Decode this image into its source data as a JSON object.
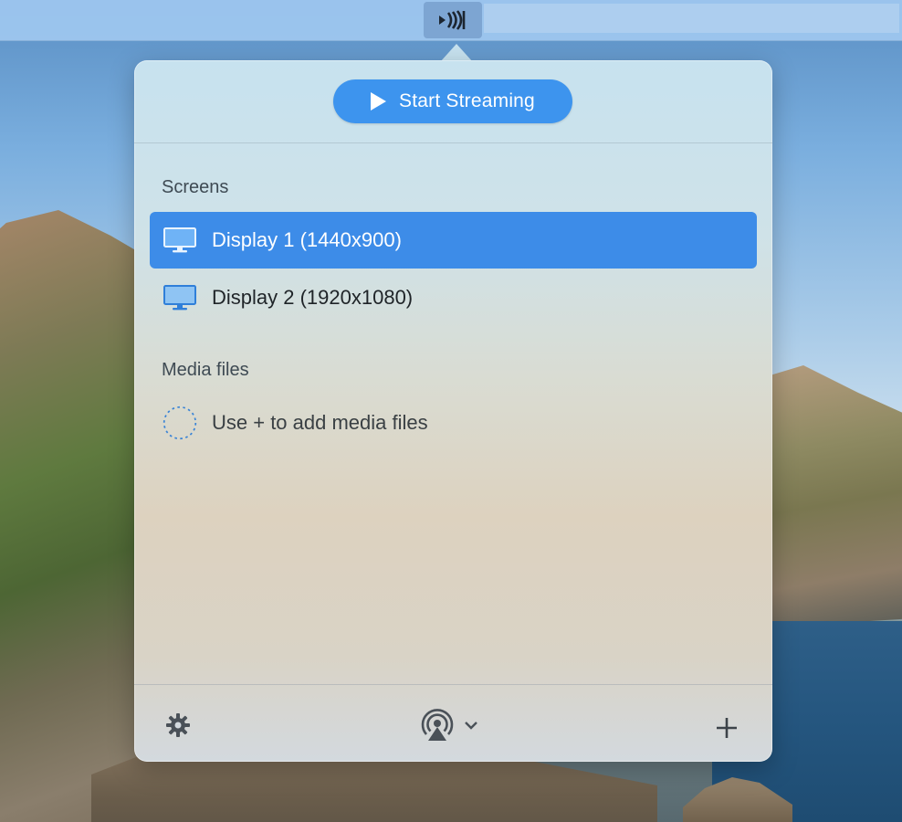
{
  "menubar": {
    "app_icon": "airbeam-stream-icon"
  },
  "header": {
    "start_label": "Start Streaming",
    "start_icon": "play-icon"
  },
  "screens": {
    "title": "Screens",
    "items": [
      {
        "label": "Display 1 (1440x900)",
        "icon": "monitor-icon",
        "selected": true
      },
      {
        "label": "Display 2 (1920x1080)",
        "icon": "monitor-icon",
        "selected": false
      }
    ]
  },
  "media": {
    "title": "Media files",
    "empty_label": "Use + to add media files",
    "empty_icon": "dashed-circle-icon"
  },
  "footer": {
    "settings_icon": "gear-icon",
    "airplay_icon": "airplay-icon",
    "chevron_icon": "chevron-down-icon",
    "add_icon": "plus-icon"
  },
  "colors": {
    "accent": "#3d94ee",
    "selected_row": "#3d8ce8",
    "monitor_icon": "#2f7fd9"
  }
}
